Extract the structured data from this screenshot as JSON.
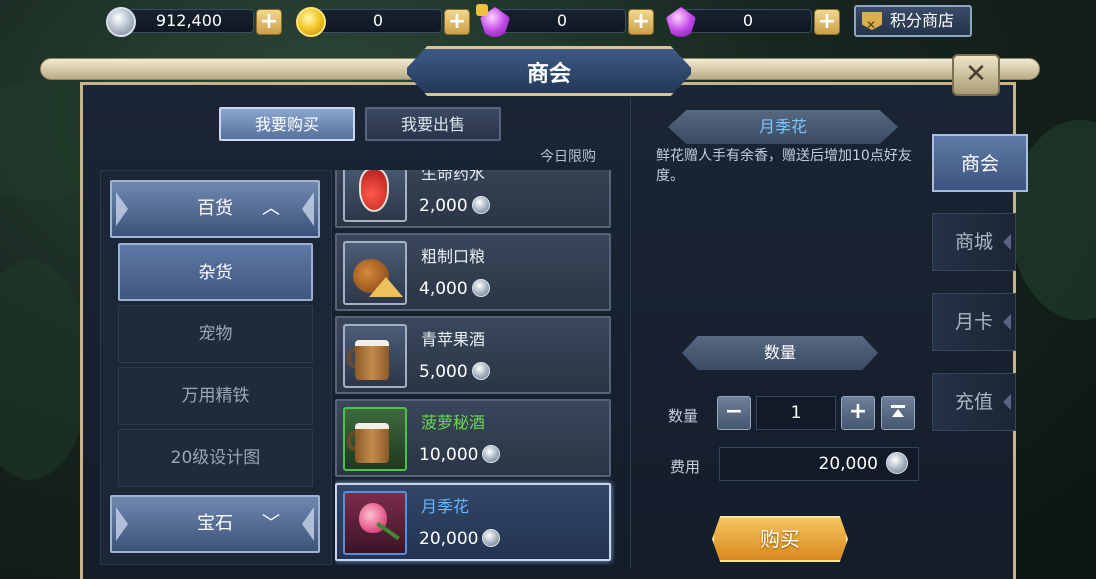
{
  "currencies": [
    {
      "name": "silver",
      "value": "912,400"
    },
    {
      "name": "gold",
      "value": "0"
    },
    {
      "name": "bound-gem",
      "value": "0"
    },
    {
      "name": "gem",
      "value": "0"
    }
  ],
  "score_shop_label": "积分商店",
  "window_title": "商会",
  "tabs": {
    "buy": "我要购买",
    "sell": "我要出售"
  },
  "daily_limit_label": "今日限购",
  "categories": {
    "head_top": "百货",
    "subs": [
      "杂货",
      "宠物",
      "万用精铁",
      "20级设计图"
    ],
    "head_bottom": "宝石"
  },
  "items": [
    {
      "name": "生命药水",
      "price": "2,000",
      "icon": "potion-icon"
    },
    {
      "name": "粗制口粮",
      "price": "4,000",
      "icon": "ration-icon"
    },
    {
      "name": "青苹果酒",
      "price": "5,000",
      "icon": "cider-icon"
    },
    {
      "name": "菠萝秘酒",
      "price": "10,000",
      "icon": "pineapple-wine-icon"
    },
    {
      "name": "月季花",
      "price": "20,000",
      "icon": "rose-icon"
    }
  ],
  "detail": {
    "name": "月季花",
    "description": "鲜花赠人手有余香，赠送后增加10点好友度。",
    "quantity_header": "数量",
    "quantity_label": "数量",
    "quantity": "1",
    "cost_label": "费用",
    "cost": "20,000",
    "buy_label": "购买"
  },
  "side_tabs": [
    "商会",
    "商城",
    "月卡",
    "充值"
  ],
  "colors": {
    "accent": "#5f7aa6",
    "item_name_green": "#6ad84a",
    "item_name_blue": "#66b6ff",
    "buy_button": "#e8a23a"
  }
}
